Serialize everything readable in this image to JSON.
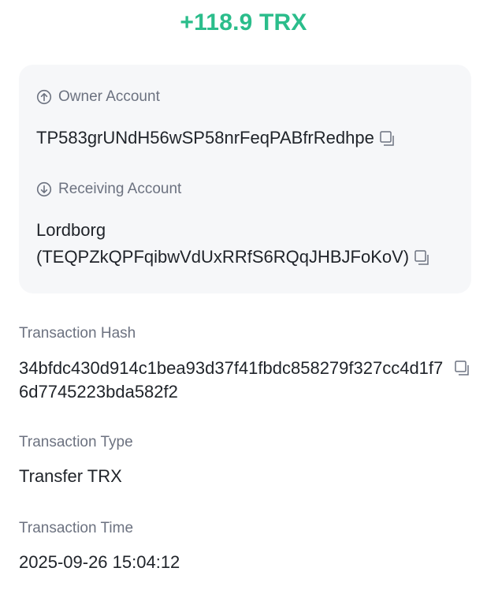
{
  "amount": "+118.9 TRX",
  "colors": {
    "amount": "#2bbd8b",
    "card_bg": "#f6f7f9",
    "label": "#6c7280",
    "text": "#1f2329"
  },
  "owner": {
    "label": "Owner Account",
    "icon": "arrow-up-circle-icon",
    "address": "TP583grUNdH56wSP58nrFeqPABfrRedhpe"
  },
  "receiving": {
    "label": "Receiving Account",
    "icon": "arrow-down-circle-icon",
    "name": "Lordborg",
    "address": "(TEQPZkQPFqibwVdUxRRfS6RQqJHBJFoKoV)"
  },
  "tx_hash": {
    "label": "Transaction Hash",
    "value": "34bfdc430d914c1bea93d37f41fbdc858279f327cc4d1f76d7745223bda582f2"
  },
  "tx_type": {
    "label": "Transaction Type",
    "value": "Transfer TRX"
  },
  "tx_time": {
    "label": "Transaction Time",
    "value": "2025-09-26 15:04:12"
  }
}
